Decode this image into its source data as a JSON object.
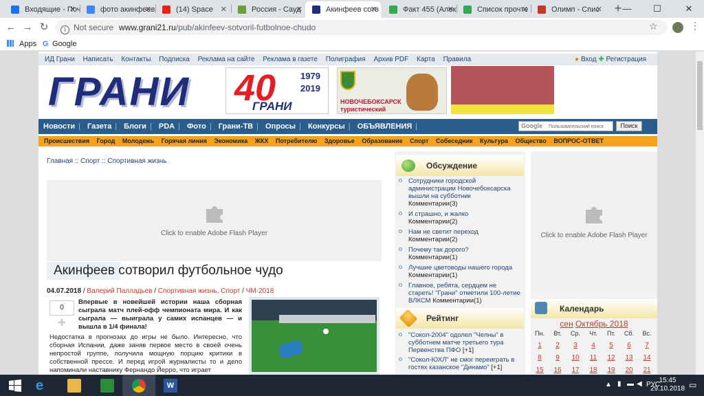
{
  "browser": {
    "tabs": [
      {
        "title": "Входящие - Почт",
        "color": "#1a73e8"
      },
      {
        "title": "фото акинфеев",
        "color": "#4285f4"
      },
      {
        "title": "(14) Space",
        "color": "#e62117"
      },
      {
        "title": "Россия - Сауд",
        "color": "#6a9f3a"
      },
      {
        "title": "Акинфеев сотв",
        "color": "#1f2d7a"
      },
      {
        "title": "Факт 455 (Алек",
        "color": "#34a853"
      },
      {
        "title": "Список прочте",
        "color": "#34a853"
      },
      {
        "title": "Олимп - Спис",
        "color": "#c0392b"
      }
    ],
    "new_tab": "+",
    "win_min": "—",
    "win_max": "☐",
    "win_close": "✕",
    "not_secure": "Not secure",
    "url_domain": "www.grani21.ru",
    "url_path": "/pub/akinfeev-sotvoril-futbolnoe-chudo",
    "bookmarks": {
      "apps": "Apps",
      "google": "Google"
    }
  },
  "site": {
    "topnav": [
      "ИД Грани",
      "Написать",
      "Контакты",
      "Подписка",
      "Реклама на сайте",
      "Реклама в газете",
      "Полиграфия",
      "Архив PDF",
      "Карта",
      "Правила"
    ],
    "login": "Вход",
    "register": "Регистрация",
    "logo": "ГРАНИ",
    "banner40": {
      "num": "40",
      "year1": "1979",
      "year2": "2019",
      "name": "ГРАНИ"
    },
    "banner_city": {
      "line1": "НОВОЧЕБОКСАРСК",
      "line2": "туристический"
    },
    "mainnav": [
      "Новости",
      "Газета",
      "Блоги",
      "PDA",
      "Фото",
      "Грани-ТВ",
      "Опросы",
      "Конкурсы",
      "ОБЪЯВЛЕНИЯ"
    ],
    "search": {
      "brand": "Google",
      "placeholder": "Пользовательский поиск",
      "button": "Поиск"
    },
    "subnav": [
      "Происшествия",
      "Город",
      "Молодежь",
      "Горячая линия",
      "Экономика",
      "ЖКХ",
      "Потребителю",
      "Здоровье",
      "Образование",
      "Спорт",
      "Собеседник",
      "Культура",
      "Общество",
      "ВОПРОС-ОТВЕТ"
    ],
    "breadcrumb": "Главная :: Спорт :: Спортивная жизнь",
    "flash_msg": "Click to enable Adobe Flash Player"
  },
  "article": {
    "title": "Акинфеев сотворил футбольное чудо",
    "date": "04.07.2018",
    "author": "Валерий Палладьев",
    "rubrics": "Спортивная жизнь, Спорт",
    "tag": "ЧМ-2018",
    "share_count": "0",
    "lead": "Впервые в новейшей истории наша сборная сыграла матч плей-офф чемпионата мира. И как сыграла — выиграла у самих испанцев — и вышла в 1/4 финала!",
    "body": "Недостатка в прогнозах до игры не было. Интересно, что сборная Испании, даже заняв первое место в своей очень непростой группе, получила мощную порцию критики в собственной прессе. И перед игрой журналисты то и дело напоминали наставнику Фернандо Йерро, что играет"
  },
  "discussion": {
    "title": "Обсуждение",
    "items": [
      {
        "text": "Сотрудники городской администрации Новочебоксарска вышли на субботник",
        "comments": "Комментарии(3)"
      },
      {
        "text": "И страшно, и жалко",
        "comments": "Комментарии(2)"
      },
      {
        "text": "Нам не светит переход",
        "comments": "Комментарии(2)"
      },
      {
        "text": "Почему так дорого?",
        "comments": "Комментарии(1)"
      },
      {
        "text": "Лучшие цветоводы нашего города",
        "comments": "Комментарии(1)"
      },
      {
        "text": "Главное, ребята, сердцем не стареть! \"Грани\" отметили 100-летие ВЛКСМ",
        "comments": "Комментарии(1)"
      }
    ]
  },
  "rating": {
    "title": "Рейтинг",
    "items": [
      {
        "text": "\"Сокол-2004\" одолел \"Челны\" в субботнем матче третьего тура Первенства ПФО",
        "score": "[+1]"
      },
      {
        "text": "\"Сокол-ЮХЛ\" не смог переиграть в гостях казанское \"Динамо\"",
        "score": "[+1]"
      }
    ]
  },
  "calendar": {
    "title": "Календарь",
    "prev": "сен",
    "month": "Октябрь 2018",
    "days": [
      "Пн.",
      "Вт.",
      "Ср.",
      "Чт.",
      "Пт.",
      "Сб.",
      "Вс."
    ],
    "week1": [
      "1",
      "2",
      "3",
      "4",
      "5",
      "6",
      "7"
    ],
    "week2": [
      "8",
      "9",
      "10",
      "11",
      "12",
      "13",
      "14"
    ],
    "week3": [
      "15",
      "16",
      "17",
      "18",
      "19",
      "20",
      "21"
    ]
  },
  "taskbar": {
    "lang": "РУС",
    "time": "15:45",
    "date": "29.10.2018"
  }
}
